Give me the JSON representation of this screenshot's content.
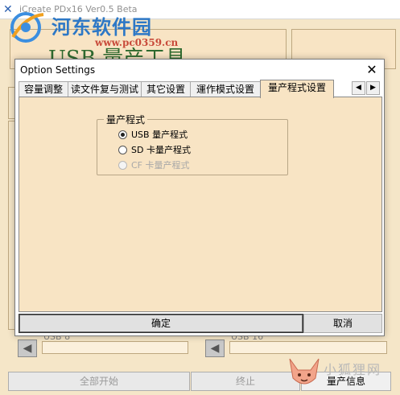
{
  "background_app": {
    "title": "iCreate PDx16 Ver0.5 Beta",
    "banner_text": "USB 量产工具",
    "watermark_top": {
      "text": "河东软件园",
      "url": "www.pc0359.cn"
    },
    "ports": [
      {
        "label": "USB 8"
      },
      {
        "label": "USB 16"
      }
    ],
    "footer": {
      "start_all": "全部开始",
      "stop": "终止",
      "info": "量产信息"
    },
    "watermark_corner": {
      "text": "小狐狸网"
    }
  },
  "dialog": {
    "title": "Option Settings",
    "tabs": [
      {
        "label": "容量调整"
      },
      {
        "label": "读文件复与测试"
      },
      {
        "label": "其它设置"
      },
      {
        "label": "運作模式设置"
      },
      {
        "label": "量产程式设置"
      }
    ],
    "active_tab": 4,
    "group_title": "量产程式",
    "options": [
      {
        "label": "USB 量产程式",
        "checked": true,
        "disabled": false
      },
      {
        "label": "SD 卡量产程式",
        "checked": false,
        "disabled": false
      },
      {
        "label": "CF 卡量产程式",
        "checked": false,
        "disabled": true
      }
    ],
    "ok_label": "确定",
    "cancel_label": "取消"
  },
  "colors": {
    "panel_beige": "#f8e4c4",
    "dialog_white": "#ffffff",
    "button_gray": "#e1e1e1"
  }
}
